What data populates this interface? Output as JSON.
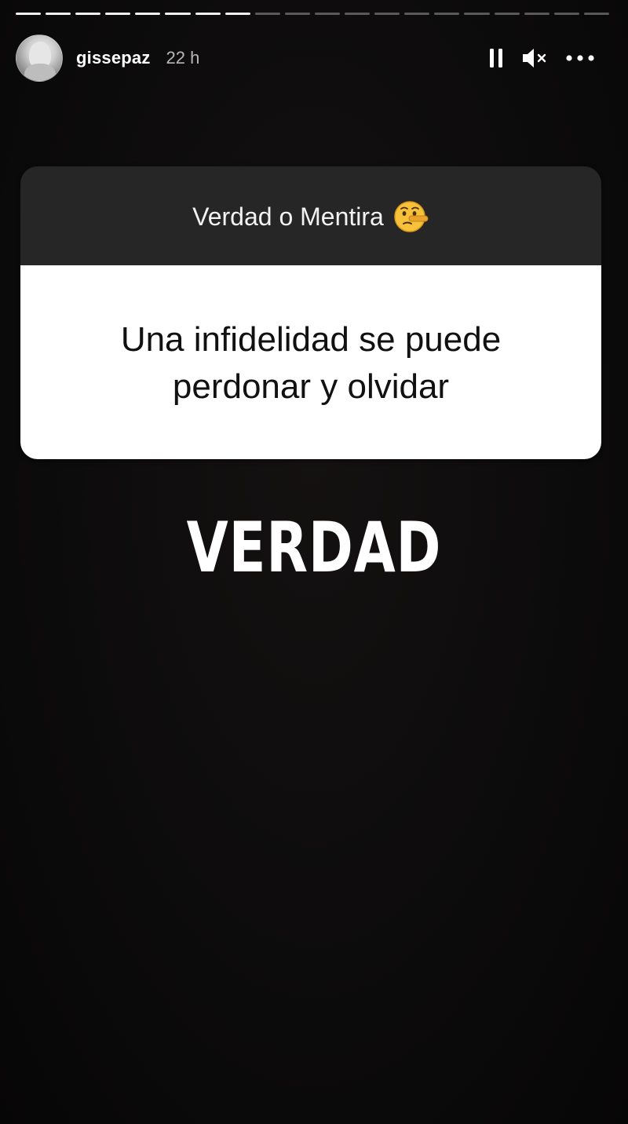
{
  "progress": {
    "total_segments": 20,
    "completed_segments": 8
  },
  "header": {
    "username": "gissepaz",
    "timestamp": "22 h",
    "icons": {
      "pause": "pause-icon",
      "mute": "speaker-muted-icon",
      "more": "more-options-icon"
    }
  },
  "question_card": {
    "prompt": "Verdad o Mentira",
    "prompt_emoji": "lying-face-emoji",
    "question": "Una infidelidad se puede perdonar y olvidar"
  },
  "answer_text": "VERDAD",
  "colors": {
    "background": "#0e0c0c",
    "card_header": "#262626",
    "card_body": "#ffffff",
    "text_light": "#ffffff",
    "text_dark": "#111111"
  }
}
